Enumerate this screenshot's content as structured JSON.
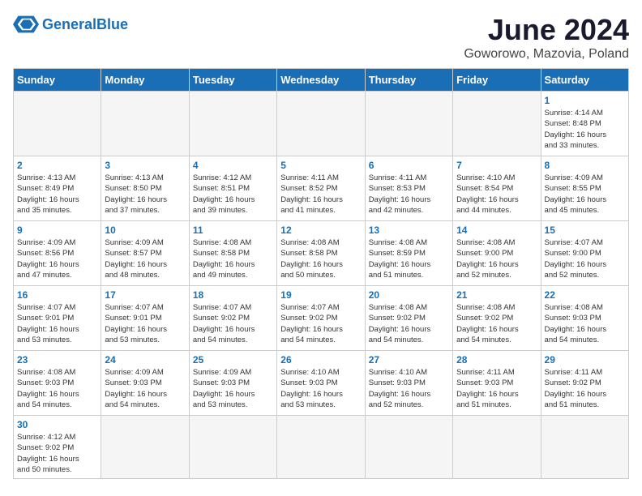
{
  "header": {
    "logo_general": "General",
    "logo_blue": "Blue",
    "month": "June 2024",
    "location": "Goworowo, Mazovia, Poland"
  },
  "weekdays": [
    "Sunday",
    "Monday",
    "Tuesday",
    "Wednesday",
    "Thursday",
    "Friday",
    "Saturday"
  ],
  "weeks": [
    [
      {
        "day": "",
        "empty": true
      },
      {
        "day": "",
        "empty": true
      },
      {
        "day": "",
        "empty": true
      },
      {
        "day": "",
        "empty": true
      },
      {
        "day": "",
        "empty": true
      },
      {
        "day": "",
        "empty": true
      },
      {
        "day": "1",
        "sunrise": "4:14 AM",
        "sunset": "8:48 PM",
        "daylight_h": "16",
        "daylight_m": "33"
      }
    ],
    [
      {
        "day": "2",
        "sunrise": "4:13 AM",
        "sunset": "8:49 PM",
        "daylight_h": "16",
        "daylight_m": "35"
      },
      {
        "day": "3",
        "sunrise": "4:13 AM",
        "sunset": "8:50 PM",
        "daylight_h": "16",
        "daylight_m": "37"
      },
      {
        "day": "4",
        "sunrise": "4:12 AM",
        "sunset": "8:51 PM",
        "daylight_h": "16",
        "daylight_m": "39"
      },
      {
        "day": "5",
        "sunrise": "4:11 AM",
        "sunset": "8:52 PM",
        "daylight_h": "16",
        "daylight_m": "41"
      },
      {
        "day": "6",
        "sunrise": "4:11 AM",
        "sunset": "8:53 PM",
        "daylight_h": "16",
        "daylight_m": "42"
      },
      {
        "day": "7",
        "sunrise": "4:10 AM",
        "sunset": "8:54 PM",
        "daylight_h": "16",
        "daylight_m": "44"
      },
      {
        "day": "8",
        "sunrise": "4:09 AM",
        "sunset": "8:55 PM",
        "daylight_h": "16",
        "daylight_m": "45"
      }
    ],
    [
      {
        "day": "9",
        "sunrise": "4:09 AM",
        "sunset": "8:56 PM",
        "daylight_h": "16",
        "daylight_m": "47"
      },
      {
        "day": "10",
        "sunrise": "4:09 AM",
        "sunset": "8:57 PM",
        "daylight_h": "16",
        "daylight_m": "48"
      },
      {
        "day": "11",
        "sunrise": "4:08 AM",
        "sunset": "8:58 PM",
        "daylight_h": "16",
        "daylight_m": "49"
      },
      {
        "day": "12",
        "sunrise": "4:08 AM",
        "sunset": "8:58 PM",
        "daylight_h": "16",
        "daylight_m": "50"
      },
      {
        "day": "13",
        "sunrise": "4:08 AM",
        "sunset": "8:59 PM",
        "daylight_h": "16",
        "daylight_m": "51"
      },
      {
        "day": "14",
        "sunrise": "4:08 AM",
        "sunset": "9:00 PM",
        "daylight_h": "16",
        "daylight_m": "52"
      },
      {
        "day": "15",
        "sunrise": "4:07 AM",
        "sunset": "9:00 PM",
        "daylight_h": "16",
        "daylight_m": "52"
      }
    ],
    [
      {
        "day": "16",
        "sunrise": "4:07 AM",
        "sunset": "9:01 PM",
        "daylight_h": "16",
        "daylight_m": "53"
      },
      {
        "day": "17",
        "sunrise": "4:07 AM",
        "sunset": "9:01 PM",
        "daylight_h": "16",
        "daylight_m": "53"
      },
      {
        "day": "18",
        "sunrise": "4:07 AM",
        "sunset": "9:02 PM",
        "daylight_h": "16",
        "daylight_m": "54"
      },
      {
        "day": "19",
        "sunrise": "4:07 AM",
        "sunset": "9:02 PM",
        "daylight_h": "16",
        "daylight_m": "54"
      },
      {
        "day": "20",
        "sunrise": "4:08 AM",
        "sunset": "9:02 PM",
        "daylight_h": "16",
        "daylight_m": "54"
      },
      {
        "day": "21",
        "sunrise": "4:08 AM",
        "sunset": "9:02 PM",
        "daylight_h": "16",
        "daylight_m": "54"
      },
      {
        "day": "22",
        "sunrise": "4:08 AM",
        "sunset": "9:03 PM",
        "daylight_h": "16",
        "daylight_m": "54"
      }
    ],
    [
      {
        "day": "23",
        "sunrise": "4:08 AM",
        "sunset": "9:03 PM",
        "daylight_h": "16",
        "daylight_m": "54"
      },
      {
        "day": "24",
        "sunrise": "4:09 AM",
        "sunset": "9:03 PM",
        "daylight_h": "16",
        "daylight_m": "54"
      },
      {
        "day": "25",
        "sunrise": "4:09 AM",
        "sunset": "9:03 PM",
        "daylight_h": "16",
        "daylight_m": "53"
      },
      {
        "day": "26",
        "sunrise": "4:10 AM",
        "sunset": "9:03 PM",
        "daylight_h": "16",
        "daylight_m": "53"
      },
      {
        "day": "27",
        "sunrise": "4:10 AM",
        "sunset": "9:03 PM",
        "daylight_h": "16",
        "daylight_m": "52"
      },
      {
        "day": "28",
        "sunrise": "4:11 AM",
        "sunset": "9:03 PM",
        "daylight_h": "16",
        "daylight_m": "51"
      },
      {
        "day": "29",
        "sunrise": "4:11 AM",
        "sunset": "9:02 PM",
        "daylight_h": "16",
        "daylight_m": "51"
      }
    ],
    [
      {
        "day": "30",
        "sunrise": "4:12 AM",
        "sunset": "9:02 PM",
        "daylight_h": "16",
        "daylight_m": "50"
      },
      {
        "day": "",
        "empty": true
      },
      {
        "day": "",
        "empty": true
      },
      {
        "day": "",
        "empty": true
      },
      {
        "day": "",
        "empty": true
      },
      {
        "day": "",
        "empty": true
      },
      {
        "day": "",
        "empty": true
      }
    ]
  ]
}
